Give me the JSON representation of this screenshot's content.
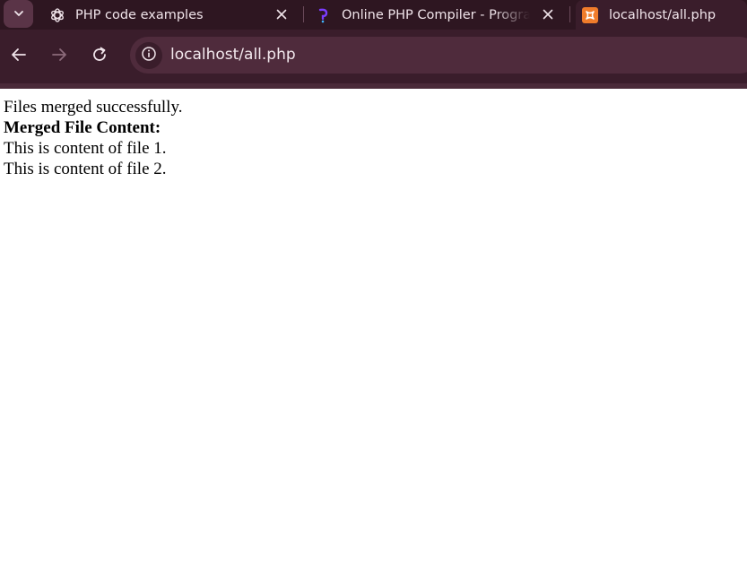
{
  "browser": {
    "tabs": [
      {
        "title": "PHP code examples",
        "icon": "chatgpt-icon",
        "active": false
      },
      {
        "title": "Online PHP Compiler - Program",
        "icon": "programiz-icon",
        "active": false
      },
      {
        "title": "localhost/all.php",
        "icon": "xampp-icon",
        "active": true
      }
    ],
    "address_bar": {
      "url": "localhost/all.php"
    },
    "colors": {
      "chrome_bg": "#3a1d2b",
      "tabstrip_bg": "#2e1621",
      "omnibox_bg": "#4f2b3c",
      "xampp_orange": "#f07c2b",
      "programiz_purple": "#7b3cff"
    }
  },
  "page": {
    "lines": [
      {
        "text": "Files merged successfully.",
        "bold": false
      },
      {
        "text": "Merged File Content:",
        "bold": true
      },
      {
        "text": "This is content of file 1.",
        "bold": false
      },
      {
        "text": "This is content of file 2.",
        "bold": false
      }
    ]
  }
}
